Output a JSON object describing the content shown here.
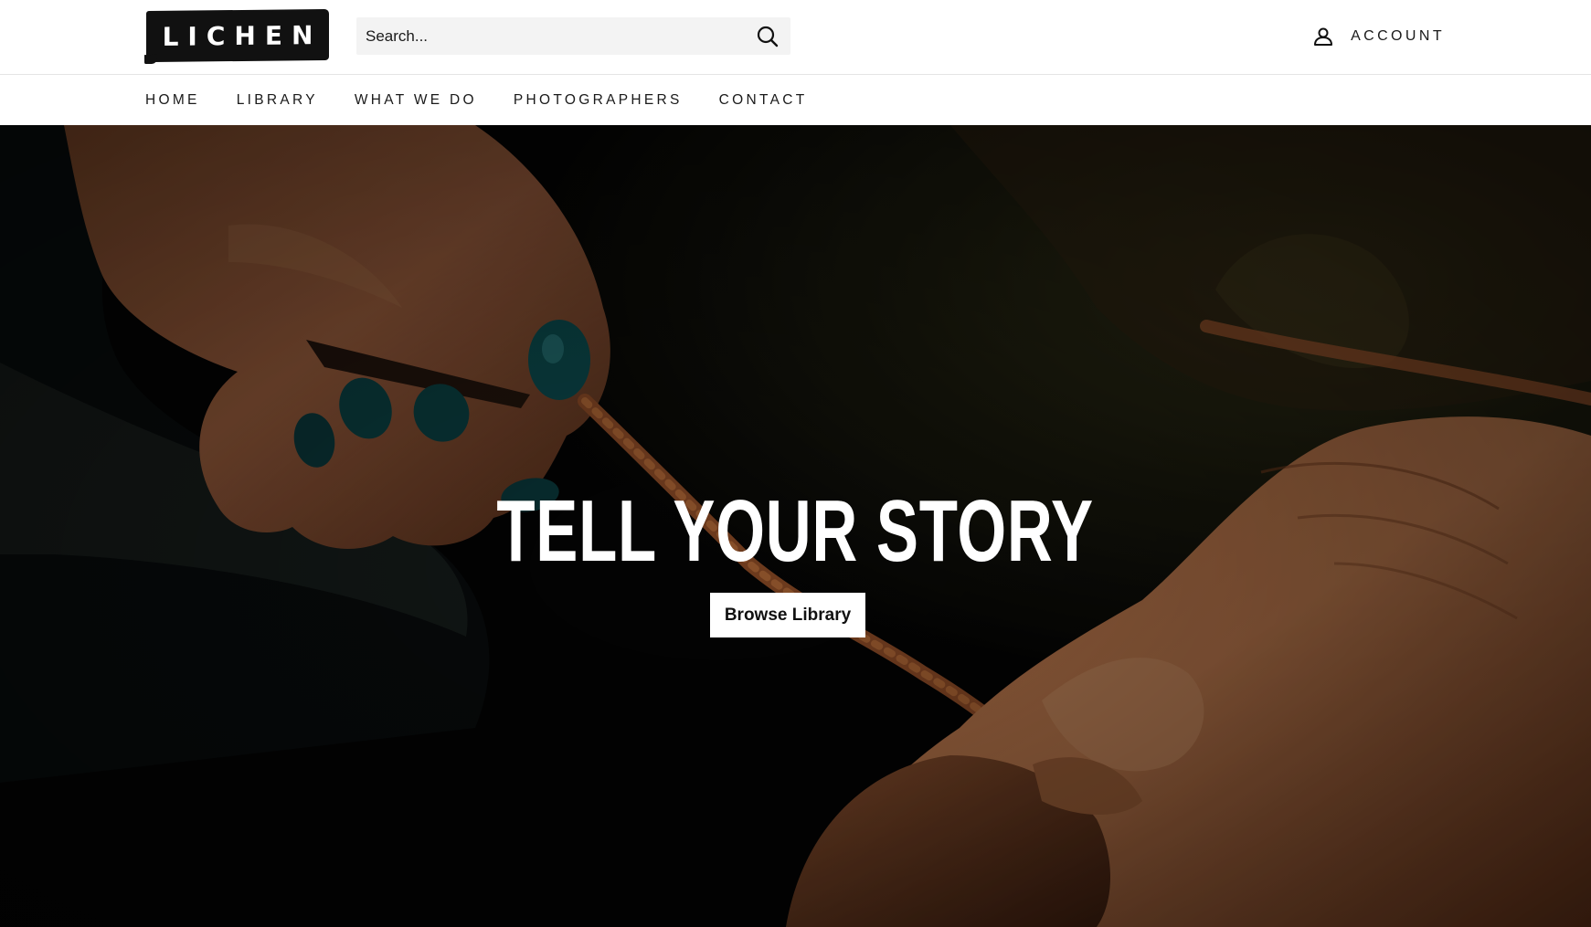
{
  "header": {
    "logo_text": "LICHEN",
    "search": {
      "placeholder": "Search..."
    },
    "account_label": "ACCOUNT"
  },
  "nav": {
    "items": [
      {
        "label": "HOME"
      },
      {
        "label": "LIBRARY"
      },
      {
        "label": "WHAT WE DO"
      },
      {
        "label": "PHOTOGRAPHERS"
      },
      {
        "label": "CONTACT"
      }
    ]
  },
  "hero": {
    "title": "TELL YOUR STORY",
    "button_label": "Browse Library",
    "image_subject": "close-up of hands braiding a cord"
  },
  "colors": {
    "brand": "#111111",
    "nail_polish": "#0f5a5e",
    "skin_tone": "#b9673a",
    "hero_overlay": "#050505"
  }
}
